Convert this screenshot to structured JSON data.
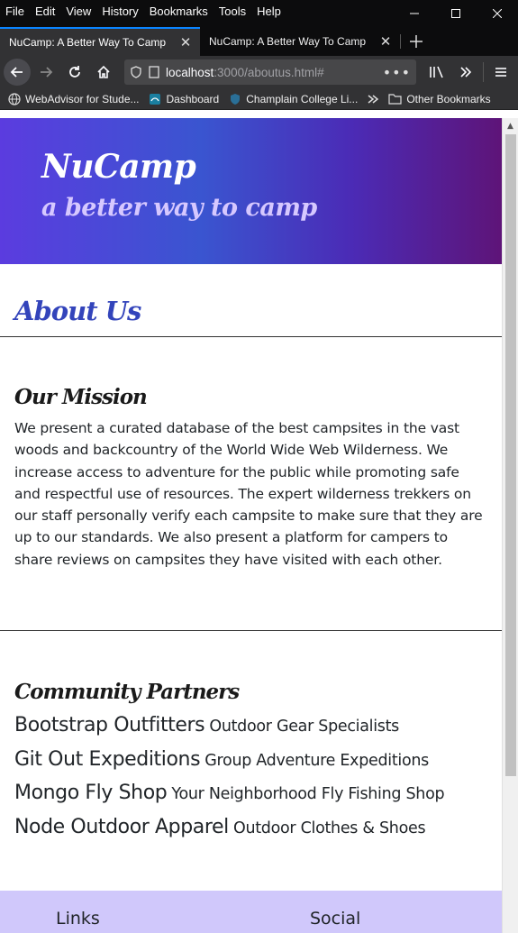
{
  "browser": {
    "menu": [
      "File",
      "Edit",
      "View",
      "History",
      "Bookmarks",
      "Tools",
      "Help"
    ],
    "tabs": [
      {
        "title": "NuCamp: A Better Way To Camp",
        "active": true
      },
      {
        "title": "NuCamp: A Better Way To Camp",
        "active": false
      }
    ],
    "url": {
      "host": "localhost",
      "rest": ":3000/aboutus.html#"
    },
    "bookmarks": [
      "WebAdvisor for Stude...",
      "Dashboard",
      "Champlain College Li..."
    ],
    "other_bookmarks": "Other Bookmarks"
  },
  "header": {
    "brand": "NuCamp",
    "tagline": "a better way to camp"
  },
  "about": {
    "title": "About Us"
  },
  "mission": {
    "heading": "Our Mission",
    "text": "We present a curated database of the best campsites in the vast woods and backcountry of the World Wide Web Wilderness. We increase access to adventure for the public while promoting safe and respectful use of resources. The expert wilderness trekkers on our staff personally verify each campsite to make sure that they are up to our standards. We also present a platform for campers to share reviews on campsites they have visited with each other."
  },
  "partners": {
    "heading": "Community Partners",
    "items": [
      {
        "name": "Bootstrap Outfitters",
        "desc": "Outdoor Gear Specialists"
      },
      {
        "name": "Git Out Expeditions",
        "desc": "Group Adventure Expeditions"
      },
      {
        "name": "Mongo Fly Shop",
        "desc": "Your Neighborhood Fly Fishing Shop"
      },
      {
        "name": "Node Outdoor Apparel",
        "desc": "Outdoor Clothes & Shoes"
      }
    ]
  },
  "footer": {
    "links_heading": "Links",
    "social_heading": "Social"
  },
  "colors": {
    "accent_tab": "#0a84ff",
    "about_title": "#3344bb",
    "footer_bg": "#d0c8fb"
  }
}
